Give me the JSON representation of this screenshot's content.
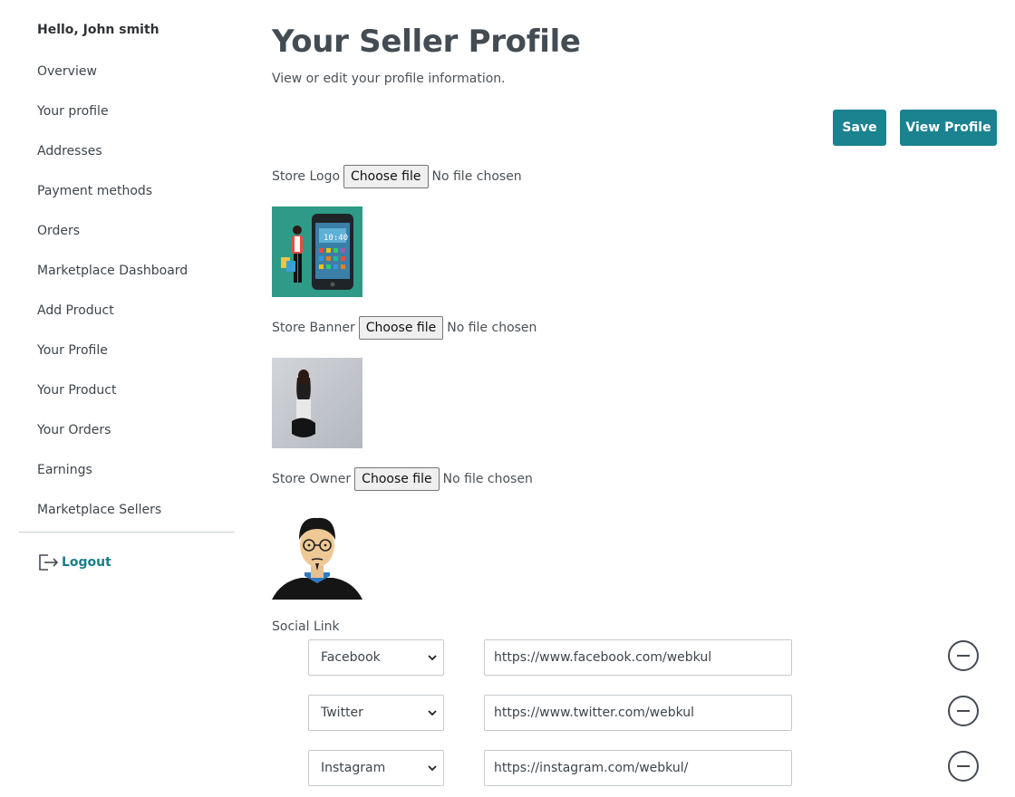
{
  "sidebar": {
    "greeting": "Hello, John smith",
    "items": [
      {
        "label": "Overview"
      },
      {
        "label": "Your profile"
      },
      {
        "label": "Addresses"
      },
      {
        "label": "Payment methods"
      },
      {
        "label": "Orders"
      },
      {
        "label": "Marketplace Dashboard"
      },
      {
        "label": "Add Product"
      },
      {
        "label": "Your Profile"
      },
      {
        "label": "Your Product"
      },
      {
        "label": "Your Orders"
      },
      {
        "label": "Earnings"
      },
      {
        "label": "Marketplace Sellers"
      }
    ],
    "logout": {
      "label": "Logout",
      "icon": "logout-icon"
    }
  },
  "main": {
    "title": "Your Seller Profile",
    "subtitle": "View or edit your profile information.",
    "buttons": {
      "save": "Save",
      "view_profile": "View Profile"
    },
    "uploads": [
      {
        "label": "Store Logo",
        "button": "Choose file",
        "status": "No file chosen"
      },
      {
        "label": "Store Banner",
        "button": "Choose file",
        "status": "No file chosen"
      },
      {
        "label": "Store Owner",
        "button": "Choose file",
        "status": "No file chosen"
      }
    ],
    "social": {
      "label": "Social Link",
      "links": [
        {
          "network": "Facebook",
          "url": "https://www.facebook.com/webkul"
        },
        {
          "network": "Twitter",
          "url": "https://www.twitter.com/webkul"
        },
        {
          "network": "Instagram",
          "url": "https://instagram.com/webkul/"
        }
      ]
    }
  },
  "colors": {
    "accent": "#1b8290",
    "logout": "#1b7e8a",
    "title": "#434b53",
    "logo_bg": "#2e9a87"
  }
}
